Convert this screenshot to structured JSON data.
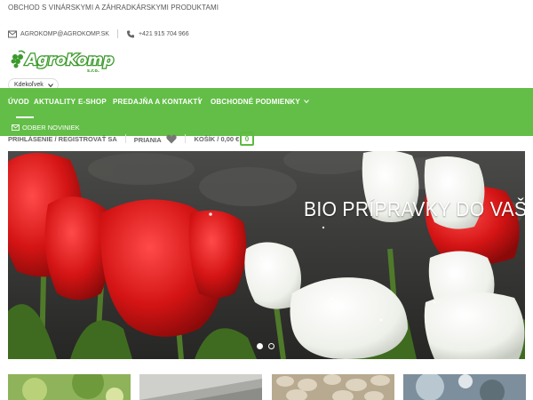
{
  "topbar": {
    "tagline": "OBCHOD S VINÁRSKYMI A ZÁHRADKÁRSKYMI PRODUKTAMI"
  },
  "contact": {
    "email": "AGROKOMP@AGROKOMP.SK",
    "phone": "+421 915 704 966"
  },
  "logo": {
    "name": "AgroKomp",
    "suffix": "s.r.o."
  },
  "search": {
    "category_selected": "Kdekoľvek"
  },
  "nav": {
    "items": [
      "ÚVOD",
      "AKTUALITY",
      "E-SHOP",
      "PREDAJŇA A KONTAKTY",
      "OBCHODNÉ PODMIENKY"
    ],
    "separator": "|",
    "newsletter": "ODBER NOVINIEK"
  },
  "account": {
    "login": "PRIHLÁSENIE / REGISTROVAŤ SA",
    "wishlist": "PRIANIA",
    "cart": "KOŠÍK / 0,00 €",
    "cart_count": "0"
  },
  "slider": {
    "caption": "BIO PRÍPRAVKY DO VAŠ",
    "slide_count": 2,
    "active_slide": 1
  },
  "colors": {
    "brand_green": "#5dbb3f",
    "logo_green": "#3c9a2c"
  },
  "icons": {
    "email": "envelope-icon",
    "phone": "phone-icon",
    "wishlist": "heart-icon",
    "dropdown": "chevron-down-icon"
  }
}
